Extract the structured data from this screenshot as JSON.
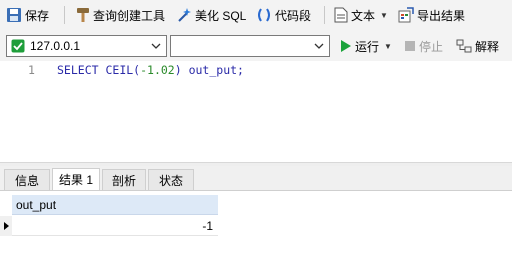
{
  "toolbar": {
    "save": {
      "label": "保存",
      "icon": "save-icon"
    },
    "query_builder": {
      "label": "查询创建工具",
      "icon": "hammer-icon"
    },
    "beautify": {
      "label": "美化 SQL",
      "icon": "magic-wand-icon"
    },
    "code_snippet": {
      "label": "代码段",
      "icon": "parentheses-icon"
    },
    "text": {
      "label": "文本",
      "icon": "document-icon"
    },
    "export": {
      "label": "导出结果",
      "icon": "export-icon"
    }
  },
  "connection": {
    "host": "127.0.0.1",
    "database": "",
    "run_label": "运行",
    "stop_label": "停止",
    "explain_label": "解释"
  },
  "editor": {
    "line_number": "1",
    "sql": {
      "kw1": "SELECT",
      "fn": "CEIL(",
      "num": "-1.02",
      "rest": ") out_put;"
    }
  },
  "result_tabs": [
    "信息",
    "结果 1",
    "剖析",
    "状态"
  ],
  "result_grid": {
    "column": "out_put",
    "rows": [
      [
        "-1"
      ]
    ]
  },
  "colors": {
    "keyword": "#2a2aa8",
    "number": "#2a8a2a",
    "header_bg": "#dde9f7",
    "run_green": "#1aa23a"
  }
}
